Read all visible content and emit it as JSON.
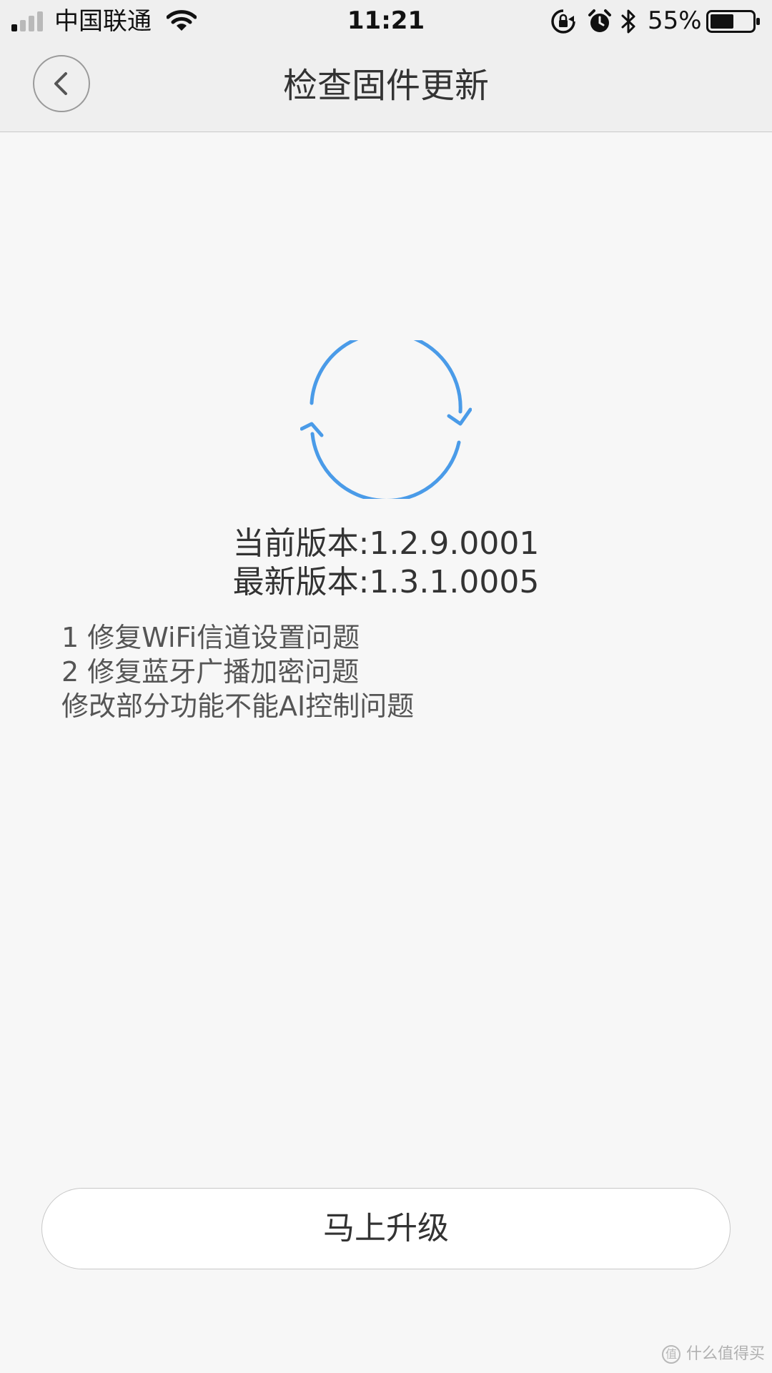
{
  "status_bar": {
    "carrier": "中国联通",
    "time": "11:21",
    "battery_percent": "55%",
    "battery_level": 0.55,
    "signal_bars_filled": 1,
    "signal_bars_total": 4
  },
  "nav": {
    "title": "检查固件更新",
    "back_icon": "chevron-left-icon"
  },
  "refresh_icon": "refresh-icon",
  "colors": {
    "accent": "#4a9be8",
    "background": "#f7f7f7",
    "nav_background": "#efefef"
  },
  "version": {
    "current": "当前版本:1.2.9.0001",
    "latest": "最新版本:1.3.1.0005"
  },
  "release_notes": [
    "1 修复WiFi信道设置问题",
    "2 修复蓝牙广播加密问题",
    "修改部分功能不能AI控制问题"
  ],
  "upgrade_button": {
    "label": "马上升级"
  },
  "watermark": {
    "text": "什么值得买"
  }
}
